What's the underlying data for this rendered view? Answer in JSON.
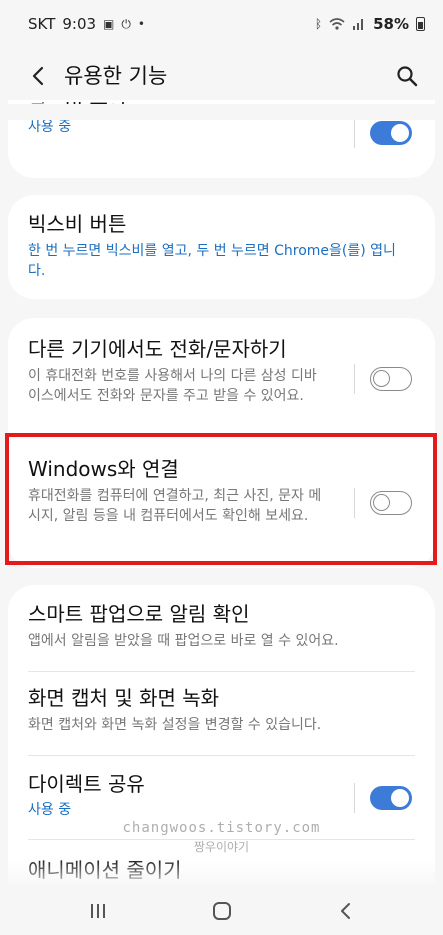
{
  "status_bar": {
    "carrier": "SKT",
    "time": "9:03",
    "battery": "58%"
  },
  "header": {
    "title": "유용한 기능"
  },
  "items": {
    "bixby_routines": {
      "title": "빅스비 루틴",
      "status": "사용 중",
      "enabled": true
    },
    "bixby_button": {
      "title": "빅스비 버튼",
      "description": "한 번 누르면 빅스비를 열고, 두 번 누르면 Chrome을(를) 엽니다."
    },
    "call_text_other": {
      "title": "다른 기기에서도 전화/문자하기",
      "description": "이 휴대전화 번호를 사용해서 나의 다른 삼성 디바이스에서도 전화와 문자를 주고 받을 수 있어요.",
      "enabled": false
    },
    "link_windows": {
      "title": "Windows와 연결",
      "description": "휴대전화를 컴퓨터에 연결하고, 최근 사진, 문자 메시지, 알림 등을 내 컴퓨터에서도 확인해 보세요.",
      "enabled": false
    },
    "smart_popup": {
      "title": "스마트 팝업으로 알림 확인",
      "description": "앱에서 알림을 받았을 때 팝업으로 바로 열 수 있어요."
    },
    "screenshot_record": {
      "title": "화면 캡처 및 화면 녹화",
      "description": "화면 캡처와 화면 녹화 설정을 변경할 수 있습니다."
    },
    "direct_share": {
      "title": "다이렉트 공유",
      "status": "사용 중",
      "enabled": true
    },
    "reduce_animations": {
      "title": "애니메이션 줄이기"
    }
  },
  "watermark": {
    "line1": "changwoos.tistory.com",
    "line2": "짱우이야기"
  },
  "colors": {
    "accent": "#3d7bd9",
    "link_blue": "#1b6fc0",
    "highlight": "#e31b1b"
  }
}
